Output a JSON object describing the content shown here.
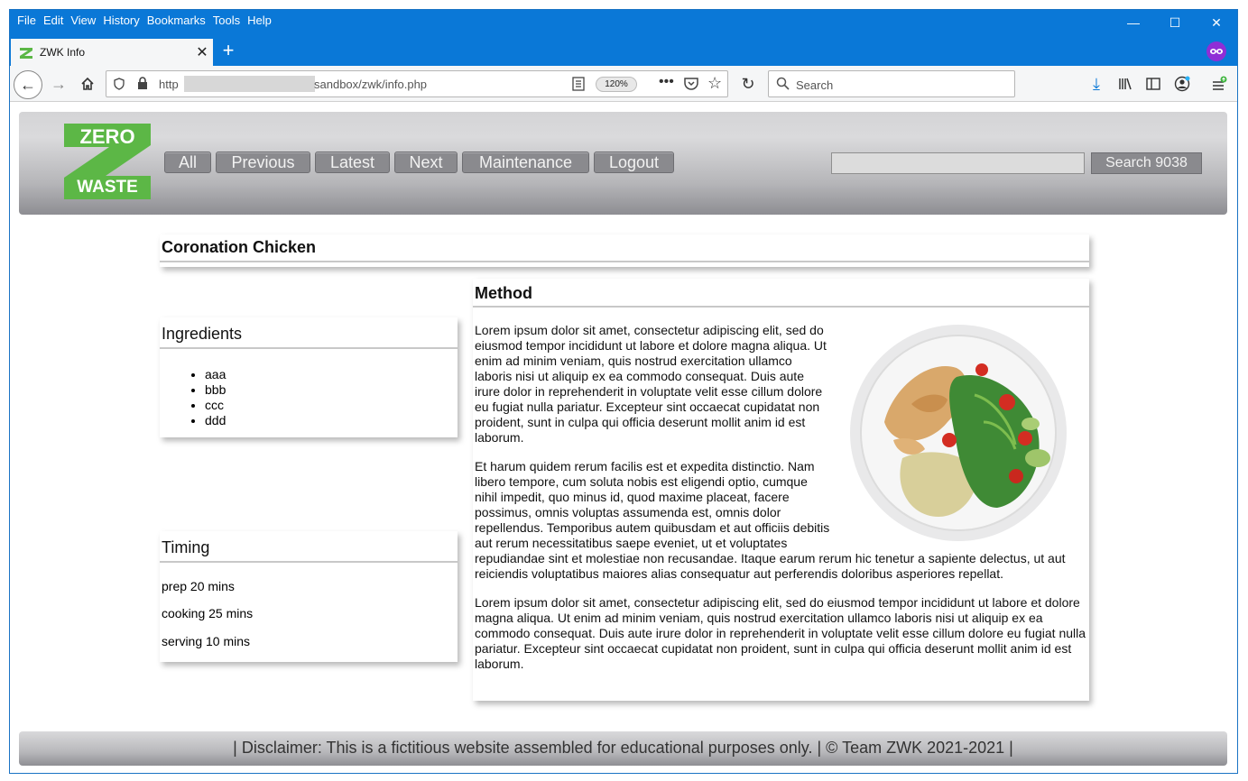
{
  "browser": {
    "menu": [
      "File",
      "Edit",
      "View",
      "History",
      "Bookmarks",
      "Tools",
      "Help"
    ],
    "tab_title": "ZWK Info",
    "url_prefix": "http",
    "url_path": "sandbox/zwk/info.php",
    "zoom": "120%",
    "search_placeholder": "Search"
  },
  "site": {
    "logo_top": "ZERO",
    "logo_bottom": "WASTE",
    "nav": [
      "All",
      "Previous",
      "Latest",
      "Next",
      "Maintenance",
      "Logout"
    ],
    "search_button": "Search 9038",
    "search_value": ""
  },
  "recipe": {
    "title": "Coronation Chicken",
    "ingredients_heading": "Ingredients",
    "ingredients": [
      "aaa",
      "bbb",
      "ccc",
      "ddd"
    ],
    "timing_heading": "Timing",
    "timing": [
      "prep 20 mins",
      "cooking 25 mins",
      "serving 10 mins"
    ],
    "method_heading": "Method",
    "method": [
      "Lorem ipsum dolor sit amet, consectetur adipiscing elit, sed do eiusmod tempor incididunt ut labore et dolore magna aliqua. Ut enim ad minim veniam, quis nostrud exercitation ullamco laboris nisi ut aliquip ex ea commodo consequat. Duis aute irure dolor in reprehenderit in voluptate velit esse cillum dolore eu fugiat nulla pariatur. Excepteur sint occaecat cupidatat non proident, sunt in culpa qui officia deserunt mollit anim id est laborum.",
      "Et harum quidem rerum facilis est et expedita distinctio. Nam libero tempore, cum soluta nobis est eligendi optio, cumque nihil impedit, quo minus id, quod maxime placeat, facere possimus, omnis voluptas assumenda est, omnis dolor repellendus. Temporibus autem quibusdam et aut officiis debitis aut rerum necessitatibus saepe eveniet, ut et voluptates repudiandae sint et molestiae non recusandae. Itaque earum rerum hic tenetur a sapiente delectus, ut aut reiciendis voluptatibus maiores alias consequatur aut perferendis doloribus asperiores repellat.",
      "Lorem ipsum dolor sit amet, consectetur adipiscing elit, sed do eiusmod tempor incididunt ut labore et dolore magna aliqua. Ut enim ad minim veniam, quis nostrud exercitation ullamco laboris nisi ut aliquip ex ea commodo consequat. Duis aute irure dolor in reprehenderit in voluptate velit esse cillum dolore eu fugiat nulla pariatur. Excepteur sint occaecat cupidatat non proident, sunt in culpa qui officia deserunt mollit anim id est laborum."
    ]
  },
  "footer": "| Disclaimer: This is a fictitious website assembled for educational purposes only. | © Team ZWK 2021-2021 |",
  "colors": {
    "titlebar": "#0a78d7",
    "logo_green": "#5cb746",
    "button_grey": "#8a8a8e"
  }
}
